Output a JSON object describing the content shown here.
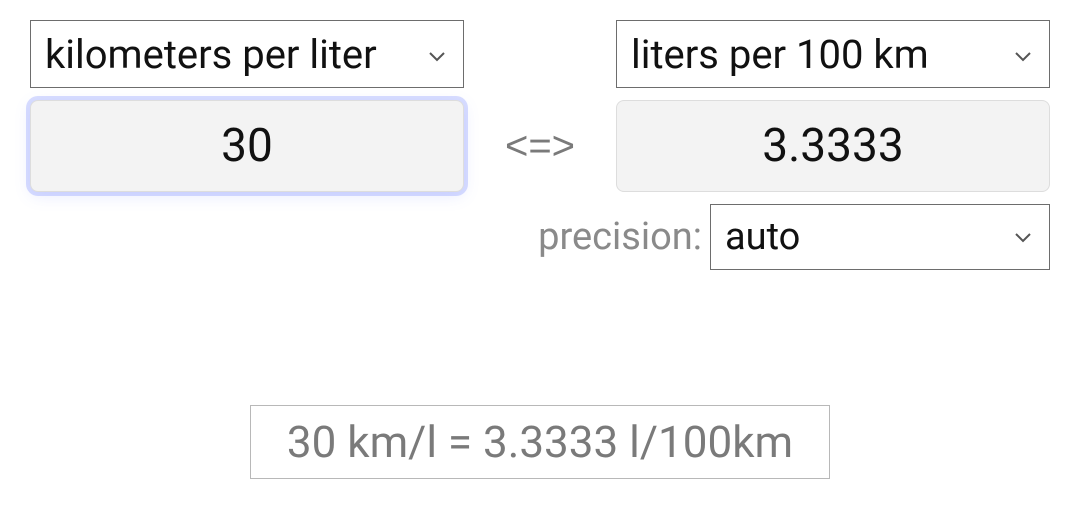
{
  "left_unit": {
    "label": "kilometers per liter"
  },
  "right_unit": {
    "label": "liters per 100 km"
  },
  "left_value": "30",
  "right_value": "3.3333",
  "arrow_symbol": "<=>",
  "precision": {
    "label": "precision:",
    "value": "auto"
  },
  "result_text": "30 km/l = 3.3333 l/100km"
}
